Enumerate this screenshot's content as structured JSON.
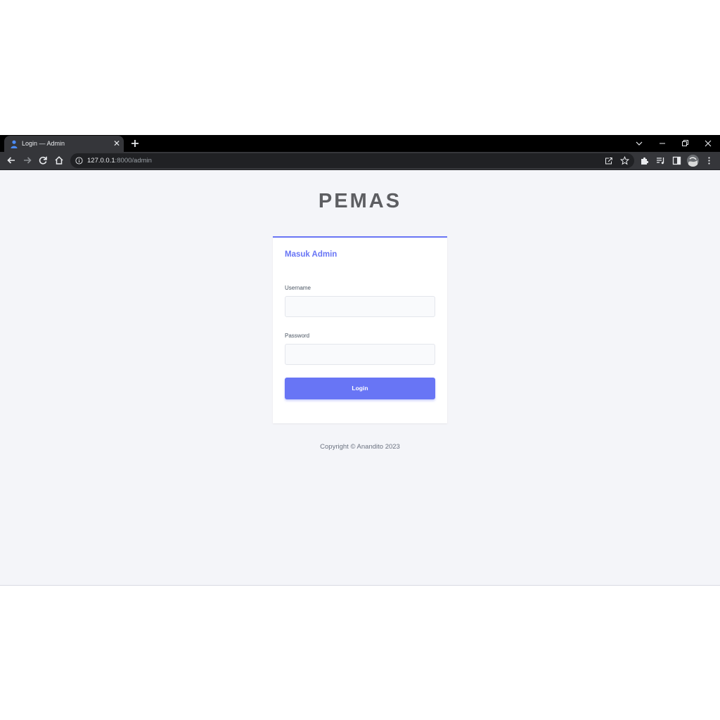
{
  "browser": {
    "tab": {
      "title": "Login — Admin",
      "favicon": "user-icon"
    },
    "url": {
      "host": "127.0.0.1",
      "rest": ":8000/admin"
    },
    "colors": {
      "tabstrip": "#000000",
      "toolbar": "#35363a",
      "omnibox": "#202124"
    }
  },
  "page": {
    "brand": "PEMAS",
    "card": {
      "title": "Masuk Admin",
      "username_label": "Username",
      "username_value": "",
      "password_label": "Password",
      "password_value": "",
      "login_label": "Login"
    },
    "footer": "Copyright © Anandito 2023",
    "colors": {
      "accent": "#6875f5",
      "background": "#f4f5f9",
      "card": "#ffffff"
    }
  }
}
